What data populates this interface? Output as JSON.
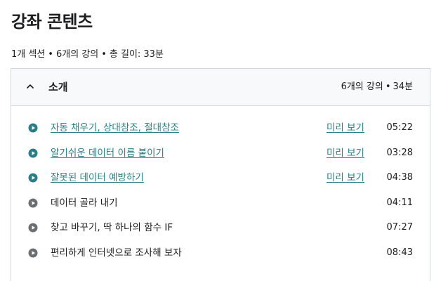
{
  "page": {
    "title": "강좌 콘텐츠"
  },
  "summary": {
    "sections": "1개 섹션",
    "lectures": "6개의 강의",
    "total_length": "총 길이: 33분",
    "separator": "•"
  },
  "section": {
    "title": "소개",
    "lectures": "6개의 강의",
    "length": "34분",
    "separator": "•",
    "expanded": true,
    "chevron_icon": "chevron-up-icon"
  },
  "colors": {
    "link": "#2a7e86",
    "play_icon_link": "#2a7e86",
    "play_icon_plain": "#6a6f73",
    "header_bg": "#f7f9fa",
    "border": "#d1d7dc"
  },
  "lectures": [
    {
      "title": "자동 채우기, 상대참조, 절대참조",
      "preview": "미리 보기",
      "duration": "05:22",
      "previewable": true,
      "icon": "play-circle-icon"
    },
    {
      "title": "알기쉬운 데이터 이름 붙이기",
      "preview": "미리 보기",
      "duration": "03:28",
      "previewable": true,
      "icon": "play-circle-icon"
    },
    {
      "title": "잘못된 데이터 예방하기",
      "preview": "미리 보기",
      "duration": "04:38",
      "previewable": true,
      "icon": "play-circle-icon"
    },
    {
      "title": "데이터 골라 내기",
      "preview": "",
      "duration": "04:11",
      "previewable": false,
      "icon": "play-circle-icon"
    },
    {
      "title": "찾고 바꾸기, 딱 하나의 함수 IF",
      "preview": "",
      "duration": "07:27",
      "previewable": false,
      "icon": "play-circle-icon"
    },
    {
      "title": "편리하게 인터넷으로 조사해 보자",
      "preview": "",
      "duration": "08:43",
      "previewable": false,
      "icon": "play-circle-icon"
    }
  ]
}
